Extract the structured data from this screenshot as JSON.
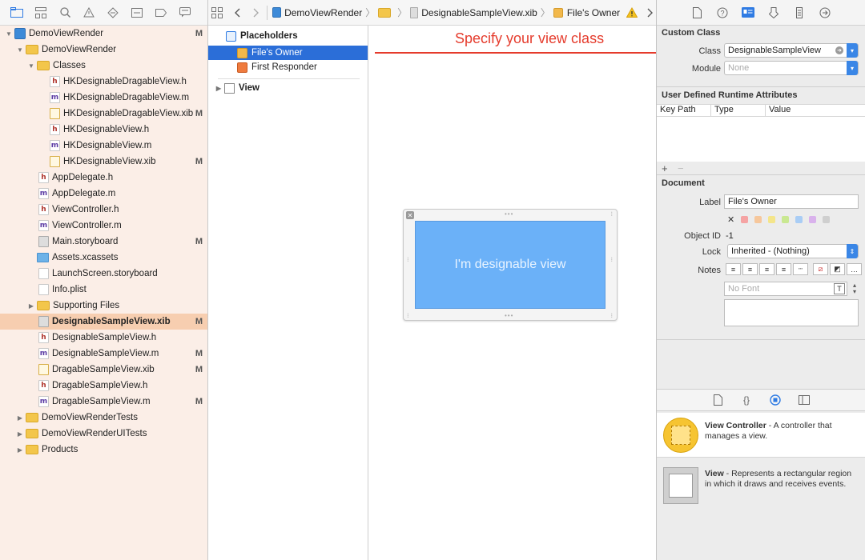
{
  "navigator": {
    "items": [
      {
        "label": "DemoViewRender",
        "badge": "M"
      },
      {
        "label": "DemoViewRender",
        "badge": ""
      },
      {
        "label": "Classes",
        "badge": ""
      },
      {
        "label": "HKDesignableDragableView.h",
        "badge": ""
      },
      {
        "label": "HKDesignableDragableView.m",
        "badge": ""
      },
      {
        "label": "HKDesignableDragableView.xib",
        "badge": "M"
      },
      {
        "label": "HKDesignableView.h",
        "badge": ""
      },
      {
        "label": "HKDesignableView.m",
        "badge": ""
      },
      {
        "label": "HKDesignableView.xib",
        "badge": "M"
      },
      {
        "label": "AppDelegate.h",
        "badge": ""
      },
      {
        "label": "AppDelegate.m",
        "badge": ""
      },
      {
        "label": "ViewController.h",
        "badge": ""
      },
      {
        "label": "ViewController.m",
        "badge": ""
      },
      {
        "label": "Main.storyboard",
        "badge": "M"
      },
      {
        "label": "Assets.xcassets",
        "badge": ""
      },
      {
        "label": "LaunchScreen.storyboard",
        "badge": ""
      },
      {
        "label": "Info.plist",
        "badge": ""
      },
      {
        "label": "Supporting Files",
        "badge": ""
      },
      {
        "label": "DesignableSampleView.xib",
        "badge": "M"
      },
      {
        "label": "DesignableSampleView.h",
        "badge": ""
      },
      {
        "label": "DesignableSampleView.m",
        "badge": "M"
      },
      {
        "label": "DragableSampleView.xib",
        "badge": "M"
      },
      {
        "label": "DragableSampleView.h",
        "badge": ""
      },
      {
        "label": "DragableSampleView.m",
        "badge": "M"
      },
      {
        "label": "DemoViewRenderTests",
        "badge": ""
      },
      {
        "label": "DemoViewRenderUITests",
        "badge": ""
      },
      {
        "label": "Products",
        "badge": ""
      }
    ]
  },
  "jumpbar": {
    "project": "DemoViewRender",
    "file": "DesignableSampleView.xib",
    "object": "File's Owner"
  },
  "outline": {
    "placeholders": "Placeholders",
    "files_owner": "File's Owner",
    "first_responder": "First Responder",
    "view": "View"
  },
  "canvas": {
    "annotation": "Specify your view class",
    "view_text": "I'm designable view"
  },
  "inspector": {
    "custom_class": {
      "title": "Custom Class",
      "class_label": "Class",
      "class_value": "DesignableSampleView",
      "module_label": "Module",
      "module_placeholder": "None"
    },
    "runtime_attrs": {
      "title": "User Defined Runtime Attributes",
      "columns": [
        "Key Path",
        "Type",
        "Value"
      ]
    },
    "document": {
      "title": "Document",
      "label_label": "Label",
      "label_value": "File's Owner",
      "object_id_label": "Object ID",
      "object_id_value": "-1",
      "lock_label": "Lock",
      "lock_value": "Inherited - (Nothing)",
      "notes_label": "Notes",
      "font_placeholder": "No Font"
    },
    "library": {
      "items": [
        {
          "title": "View Controller",
          "desc": " - A controller that manages a view."
        },
        {
          "title": "View",
          "desc": " - Represents a rectangular region in which it draws and receives events."
        }
      ]
    }
  },
  "colors": {
    "selection_navigator": "#f7ceb0",
    "selection_outline": "#2b6ed8",
    "annotation": "#e53b2c",
    "view_fill": "#6bb1f8"
  }
}
